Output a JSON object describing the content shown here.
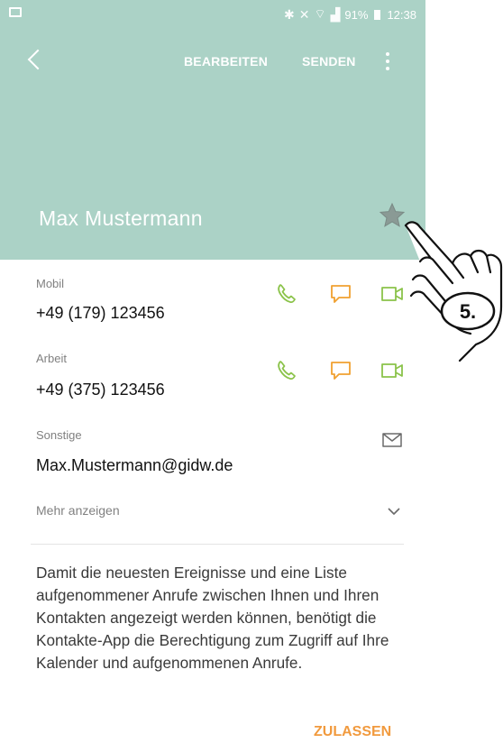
{
  "status_bar": {
    "battery": "91%",
    "time": "12:38"
  },
  "toolbar": {
    "edit_label": "BEARBEITEN",
    "send_label": "SENDEN"
  },
  "contact": {
    "name": "Max Mustermann"
  },
  "fields": [
    {
      "label": "Mobil",
      "value": "+49 (179) 123456"
    },
    {
      "label": "Arbeit",
      "value": "+49 (375) 123456"
    },
    {
      "label": "Sonstige",
      "value": "Max.Mustermann@gidw.de"
    }
  ],
  "more": {
    "label": "Mehr anzeigen"
  },
  "permission": {
    "text": "Damit die neuesten Ereignisse und eine Liste aufgenommener Anrufe zwischen Ihnen und Ihren Kontakten angezeigt werden können, benötigt die Kontakte-App die Berechtigung zum Zugriff auf Ihre Kalender und aufgenommenen Anrufe.",
    "allow_label": "ZULASSEN"
  },
  "annotation": {
    "step": "5."
  },
  "colors": {
    "header": "#abd2c6",
    "call_icon": "#8bc34a",
    "message_icon": "#f0a030",
    "video_icon": "#8bc34a",
    "allow": "#f19a3e"
  }
}
